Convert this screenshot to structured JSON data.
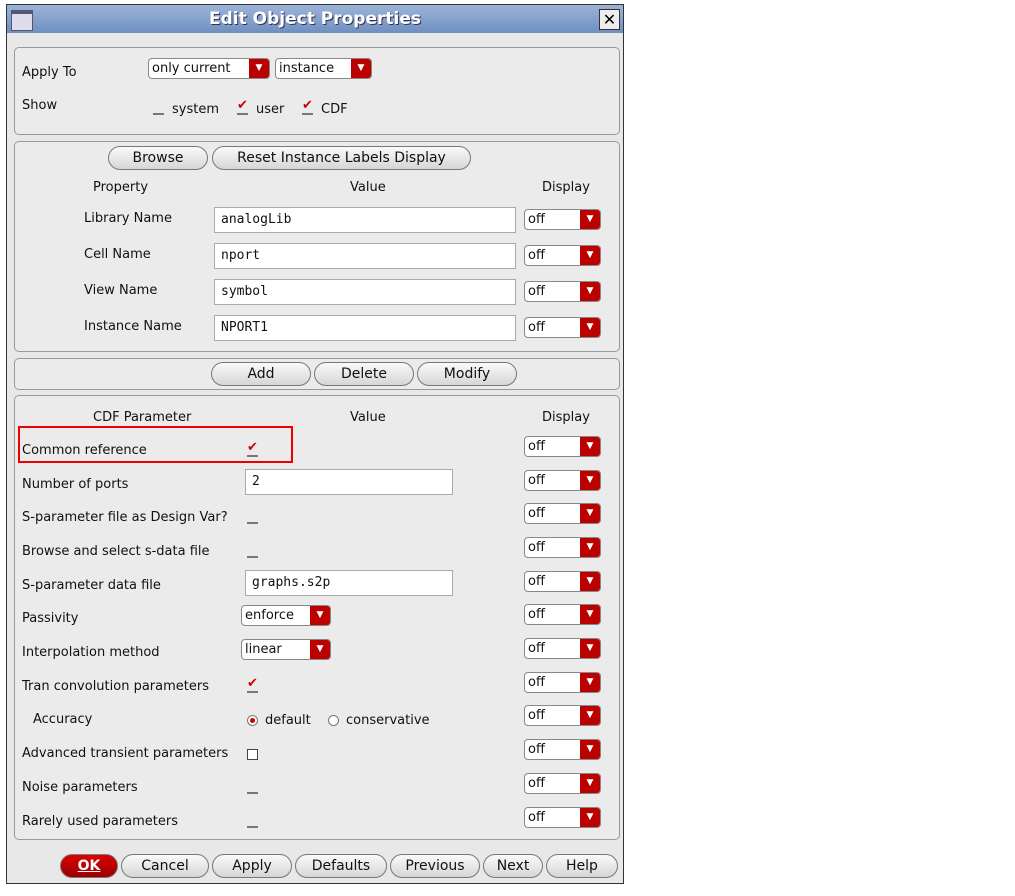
{
  "title": "Edit Object Properties",
  "apply_to": {
    "label": "Apply To",
    "scope": "only current",
    "type": "instance"
  },
  "show": {
    "label": "Show",
    "system": {
      "label": "system",
      "checked": false
    },
    "user": {
      "label": "user",
      "checked": true
    },
    "cdf": {
      "label": "CDF",
      "checked": true
    }
  },
  "props": {
    "browse": "Browse",
    "reset": "Reset Instance Labels Display",
    "col_property": "Property",
    "col_value": "Value",
    "col_display": "Display",
    "rows": [
      {
        "label": "Library Name",
        "value": "analogLib",
        "display": "off"
      },
      {
        "label": "Cell Name",
        "value": "nport",
        "display": "off"
      },
      {
        "label": "View Name",
        "value": "symbol",
        "display": "off"
      },
      {
        "label": "Instance Name",
        "value": "NPORT1",
        "display": "off"
      }
    ]
  },
  "edit": {
    "add": "Add",
    "delete": "Delete",
    "modify": "Modify"
  },
  "cdf": {
    "col_param": "CDF Parameter",
    "col_value": "Value",
    "col_display": "Display",
    "rows": [
      {
        "label": "Common reference",
        "kind": "check",
        "checked": true,
        "display": "off"
      },
      {
        "label": "Number of ports",
        "kind": "text",
        "value": "2",
        "display": "off"
      },
      {
        "label": "S-parameter file as Design Var?",
        "kind": "check",
        "checked": false,
        "display": "off"
      },
      {
        "label": "Browse and select s-data file",
        "kind": "check",
        "checked": false,
        "display": "off"
      },
      {
        "label": "S-parameter data file",
        "kind": "text",
        "value": "graphs.s2p",
        "display": "off"
      },
      {
        "label": "Passivity",
        "kind": "select",
        "value": "enforce",
        "display": "off"
      },
      {
        "label": "Interpolation method",
        "kind": "select",
        "value": "linear",
        "display": "off"
      },
      {
        "label": "Tran convolution parameters",
        "kind": "check",
        "checked": true,
        "display": "off"
      },
      {
        "label": "Accuracy",
        "kind": "radio",
        "options": [
          "default",
          "conservative"
        ],
        "selected": "default",
        "display": "off"
      },
      {
        "label": "Advanced transient parameters",
        "kind": "check",
        "checked": false,
        "boxed": true,
        "display": "off"
      },
      {
        "label": "Noise parameters",
        "kind": "check",
        "checked": false,
        "display": "off"
      },
      {
        "label": "Rarely used parameters",
        "kind": "check",
        "checked": false,
        "display": "off"
      }
    ]
  },
  "buttons": {
    "ok": "OK",
    "cancel": "Cancel",
    "apply": "Apply",
    "defaults": "Defaults",
    "previous": "Previous",
    "next": "Next",
    "help": "Help"
  }
}
